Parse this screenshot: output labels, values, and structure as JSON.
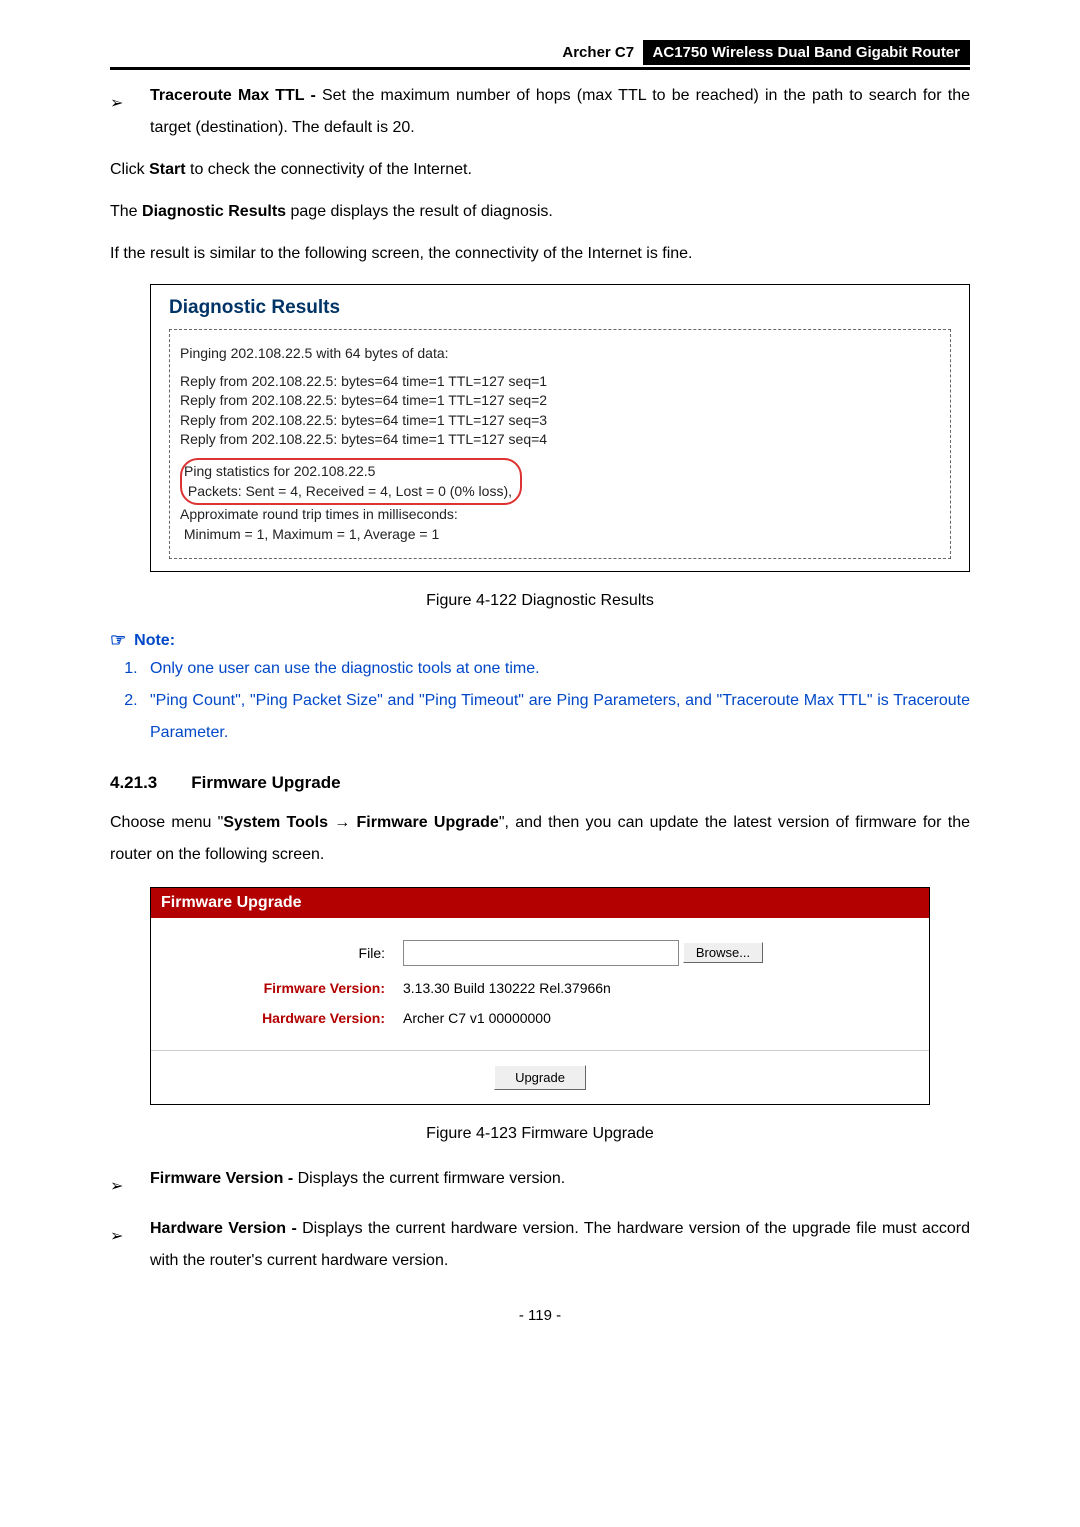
{
  "header": {
    "model": "Archer C7",
    "title": "AC1750 Wireless Dual Band Gigabit Router"
  },
  "intro": {
    "traceroute_label": "Traceroute Max TTL - ",
    "traceroute_text": "Set the maximum number of hops (max TTL to be reached) in the path to search for the target (destination). The default is 20.",
    "click_start_pre": "Click ",
    "click_start_bold": "Start",
    "click_start_post": " to check the connectivity of the Internet.",
    "diag_results_pre": "The ",
    "diag_results_bold": "Diagnostic Results",
    "diag_results_post": " page displays the result of diagnosis.",
    "similar_line": "If the result is similar to the following screen, the connectivity of the Internet is fine."
  },
  "diag": {
    "title": "Diagnostic Results",
    "pinging": "Pinging 202.108.22.5 with 64 bytes of data:",
    "reply1": "Reply from 202.108.22.5:  bytes=64  time=1  TTL=127  seq=1",
    "reply2": "Reply from 202.108.22.5:  bytes=64  time=1  TTL=127  seq=2",
    "reply3": "Reply from 202.108.22.5:  bytes=64  time=1  TTL=127  seq=3",
    "reply4": "Reply from 202.108.22.5:  bytes=64  time=1  TTL=127  seq=4",
    "stats1": "Ping statistics for 202.108.22.5",
    "stats2": " Packets: Sent = 4, Received = 4, Lost = 0 (0% loss),",
    "approx": "Approximate round trip times in milliseconds:",
    "minmax": " Minimum = 1, Maximum = 1, Average = 1"
  },
  "fig1_caption": "Figure 4-122 Diagnostic Results",
  "note": {
    "label": "Note:",
    "item1": "Only one user can use the diagnostic tools at one time.",
    "item2": "\"Ping Count\", \"Ping Packet Size\" and \"Ping Timeout\" are Ping Parameters, and \"Traceroute Max TTL\" is Traceroute Parameter."
  },
  "section_heading": "4.21.3  Firmware Upgrade",
  "fw_intro_pre": "Choose menu \"",
  "fw_intro_bold1": "System Tools",
  "fw_intro_arrow": " → ",
  "fw_intro_bold2": "Firmware Upgrade",
  "fw_intro_post": "\", and then you can update the latest version of firmware for the router on the following screen.",
  "fwbox": {
    "header": "Firmware Upgrade",
    "file_label": "File:",
    "browse": "Browse...",
    "fw_ver_label": "Firmware Version:",
    "fw_ver_val": "3.13.30 Build 130222 Rel.37966n",
    "hw_ver_label": "Hardware Version:",
    "hw_ver_val": "Archer C7 v1 00000000",
    "upgrade": "Upgrade"
  },
  "fig2_caption": "Figure 4-123 Firmware Upgrade",
  "bullets": {
    "fw_ver_bold": "Firmware Version - ",
    "fw_ver_text": "Displays the current firmware version.",
    "hw_ver_bold": "Hardware Version - ",
    "hw_ver_text": "Displays the current hardware version. The hardware version of the upgrade file must accord with the router's current hardware version."
  },
  "page_number": "- 119 -"
}
